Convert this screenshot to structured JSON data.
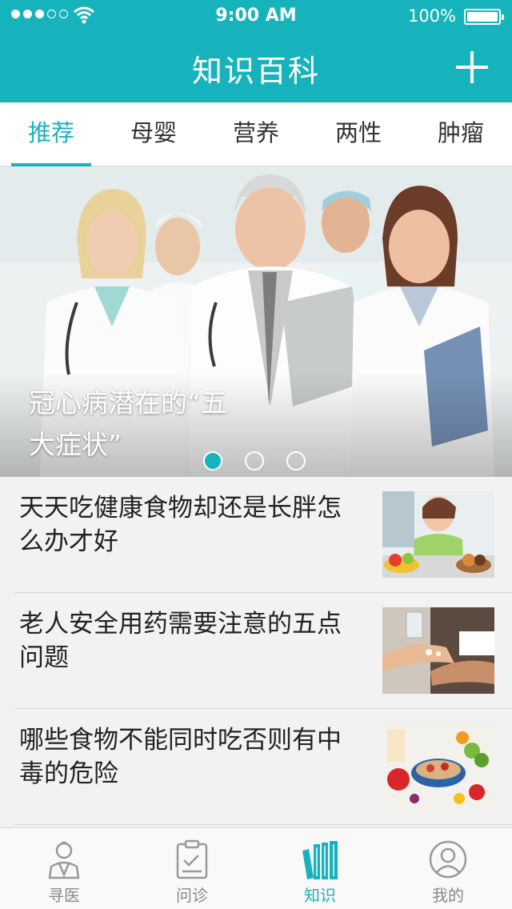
{
  "status_bar": {
    "time": "9:00 AM",
    "battery": "100%"
  },
  "nav": {
    "title": "知识百科",
    "add_icon": "plus-icon"
  },
  "tabs": [
    {
      "label": "推荐",
      "active": true
    },
    {
      "label": "母婴",
      "active": false
    },
    {
      "label": "营养",
      "active": false
    },
    {
      "label": "两性",
      "active": false
    },
    {
      "label": "肿瘤",
      "active": false
    }
  ],
  "banner": {
    "caption_line1": "冠心病潜在的“五",
    "caption_line2": "大症状”",
    "indicator_count": 3,
    "active_indicator": 1
  },
  "articles": [
    {
      "title": "天天吃健康食物却还是长胖怎么办才好"
    },
    {
      "title": "老人安全用药需要注意的五点问题"
    },
    {
      "title": "哪些食物不能同时吃否则有中毒的危险"
    }
  ],
  "tabbar": [
    {
      "label": "寻医",
      "icon": "doctor-icon",
      "active": false
    },
    {
      "label": "问诊",
      "icon": "clipboard-icon",
      "active": false
    },
    {
      "label": "知识",
      "icon": "books-icon",
      "active": true
    },
    {
      "label": "我的",
      "icon": "user-icon",
      "active": false
    }
  ],
  "colors": {
    "accent": "#17b3bd",
    "background": "#f2f2f2",
    "text": "#222222"
  }
}
